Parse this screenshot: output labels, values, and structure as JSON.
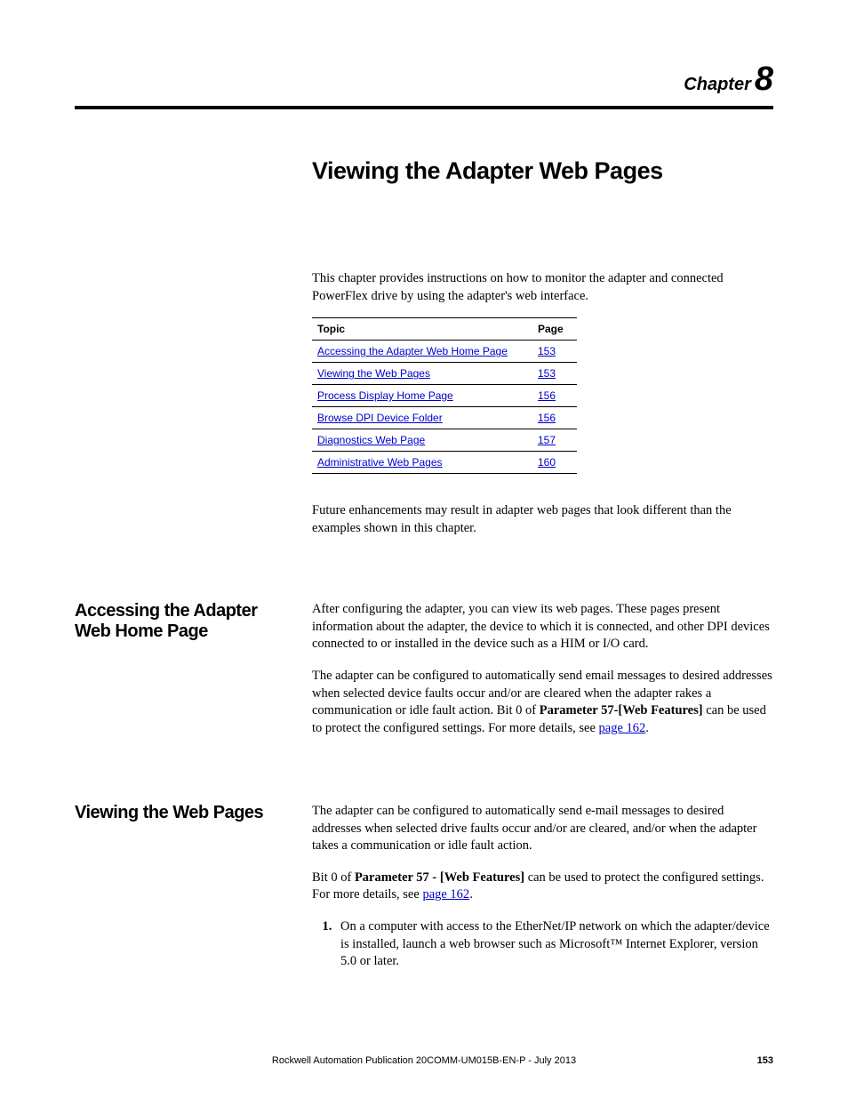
{
  "chapter": {
    "label": "Chapter",
    "number": "8"
  },
  "title": "Viewing the Adapter Web Pages",
  "intro": "This chapter provides instructions on how to monitor the adapter and connected PowerFlex drive by using the adapter's web interface.",
  "table": {
    "headers": {
      "topic": "Topic",
      "page": "Page"
    },
    "rows": [
      {
        "topic": "Accessing the Adapter Web Home Page",
        "page": "153"
      },
      {
        "topic": "Viewing the Web Pages",
        "page": "153"
      },
      {
        "topic": "Process Display Home Page",
        "page": "156"
      },
      {
        "topic": "Browse DPI Device Folder",
        "page": "156"
      },
      {
        "topic": "Diagnostics Web Page",
        "page": "157"
      },
      {
        "topic": "Administrative Web Pages",
        "page": "160"
      }
    ]
  },
  "post_table": "Future enhancements may result in adapter web pages that look different than the examples shown in this chapter.",
  "sections": {
    "accessing": {
      "heading": "Accessing the Adapter Web Home Page",
      "p1": "After configuring the adapter, you can view its web pages. These pages present information about the adapter, the device to which it is connected, and other DPI devices connected to or installed in the device such as a HIM or I/O card.",
      "p2_pre": "The adapter can be configured to automatically send email messages to desired addresses when selected device faults occur and/or are cleared when the adapter rakes a communication or idle fault action. Bit 0 of ",
      "p2_bold": "Parameter 57-[Web Features]",
      "p2_mid": " can be used to protect the configured settings. For more details, see ",
      "p2_link": "page 162",
      "p2_post": "."
    },
    "viewing": {
      "heading": "Viewing the Web Pages",
      "p1": "The adapter can be configured to automatically send e-mail messages to desired addresses when selected drive faults occur and/or are cleared, and/or when the adapter takes a communication or idle fault action.",
      "p2_pre": "Bit 0 of ",
      "p2_bold": "Parameter 57 - [Web Features]",
      "p2_mid": " can be used to protect the configured settings. For more details, see ",
      "p2_link": "page 162",
      "p2_post": ".",
      "list1": "On a computer with access to the EtherNet/IP network on which the adapter/device is installed, launch a web browser such as Microsoft™ Internet Explorer, version 5.0 or later."
    }
  },
  "footer": {
    "text": "Rockwell Automation Publication 20COMM-UM015B-EN-P - July 2013",
    "page": "153"
  }
}
